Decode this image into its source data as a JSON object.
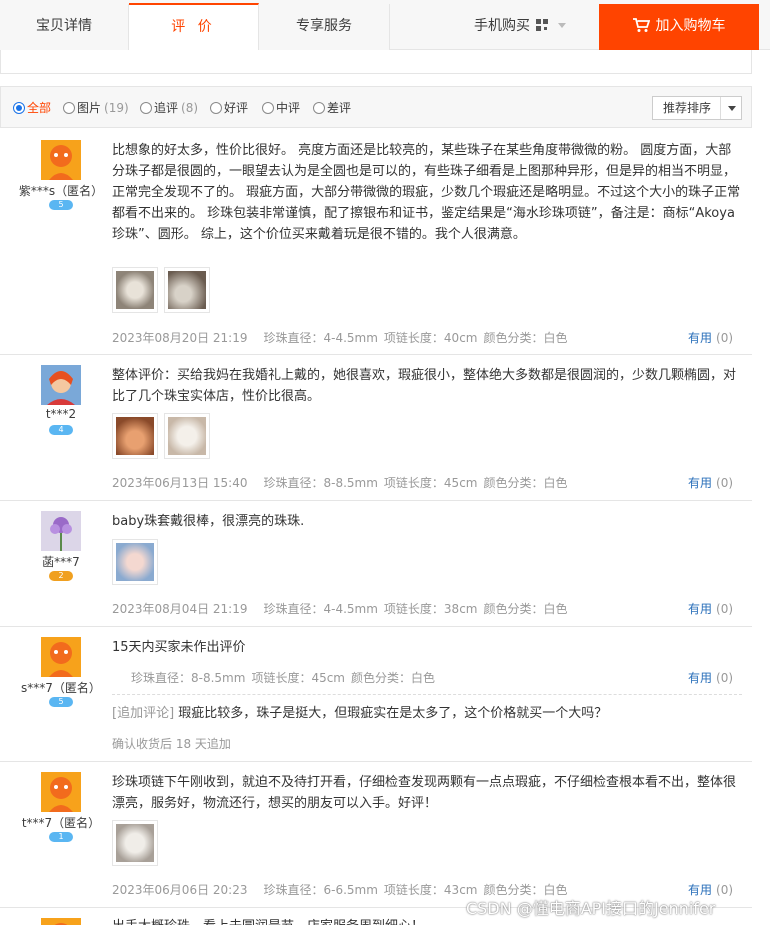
{
  "tabs": {
    "detail": "宝贝详情",
    "review": "评 价",
    "service": "专享服务",
    "mobile_buy": "手机购买",
    "add_to_cart": "加入购物车"
  },
  "filter": {
    "all": "全部",
    "pictures": "图片",
    "pictures_count": "(19)",
    "append": "追评",
    "append_count": "(8)",
    "good": "好评",
    "neutral": "中评",
    "bad": "差评",
    "sort": "推荐排序"
  },
  "reviews": [
    {
      "user": "紫***s（匿名）",
      "level": "5",
      "text": "比想象的好太多，性价比很好。 亮度方面还是比较亮的，某些珠子在某些角度带微微的粉。 圆度方面，大部分珠子都是很圆的，一眼望去认为是全圆也是可以的，有些珠子细看是上图那种异形，但是异的相当不明显，正常完全发现不了的。 瑕疵方面，大部分带微微的瑕疵，少数几个瑕疵还是略明显。不过这个大小的珠子正常都看不出来的。 珍珠包装非常谨慎，配了擦银布和证书，鉴定结果是“海水珍珠项链”，备注是：商标“Akoya珍珠”、圆形。 综上，这个价位买来戴着玩是很不错的。我个人很满意。",
      "date": "2023年08月20日 21:19",
      "sku1": "珍珠直径：4-4.5mm",
      "sku2": "项链长度：40cm",
      "sku3": "颜色分类：白色",
      "useful": "有用",
      "useful_count": "(0)"
    },
    {
      "user": "t***2",
      "level": "4",
      "text": "整体评价：买给我妈在我婚礼上戴的，她很喜欢，瑕疵很小，整体绝大多数都是很圆润的，少数几颗椭圆，对比了几个珠宝实体店，性价比很高。",
      "date": "2023年06月13日 15:40",
      "sku1": "珍珠直径：8-8.5mm",
      "sku2": "项链长度：45cm",
      "sku3": "颜色分类：白色",
      "useful": "有用",
      "useful_count": "(0)"
    },
    {
      "user": "菡***7",
      "level": "2",
      "text": "baby珠套戴很棒，很漂亮的珠珠.",
      "date": "2023年08月04日 21:19",
      "sku1": "珍珠直径：4-4.5mm",
      "sku2": "项链长度：38cm",
      "sku3": "颜色分类：白色",
      "useful": "有用",
      "useful_count": "(0)"
    },
    {
      "user": "s***7（匿名）",
      "level": "5",
      "text": "15天内买家未作出评价",
      "sku1": "珍珠直径：8-8.5mm",
      "sku2": "项链长度：45cm",
      "sku3": "颜色分类：白色",
      "useful": "有用",
      "useful_count": "(0)",
      "append_tag": "[追加评论]",
      "append_text": "瑕疵比较多，珠子是挺大，但瑕疵实在是太多了，这个价格就买一个大吗？",
      "append_time": "确认收货后 18 天追加"
    },
    {
      "user": "t***7（匿名）",
      "level": "1",
      "text": "珍珠项链下午刚收到，就迫不及待打开看，仔细检查发现两颗有一点点瑕疵，不仔细检查根本看不出，整体很漂亮，服务好，物流还行，想买的朋友可以入手。好评！",
      "date": "2023年06月06日 20:23",
      "sku1": "珍珠直径：6-6.5mm",
      "sku2": "项链长度：43cm",
      "sku3": "颜色分类：白色",
      "useful": "有用",
      "useful_count": "(0)"
    },
    {
      "text": "出手大概珍珠，看上去圆润是节，店家服务周到细心！"
    }
  ],
  "watermark": "CSDN @懂电商API接口的Jennifer"
}
